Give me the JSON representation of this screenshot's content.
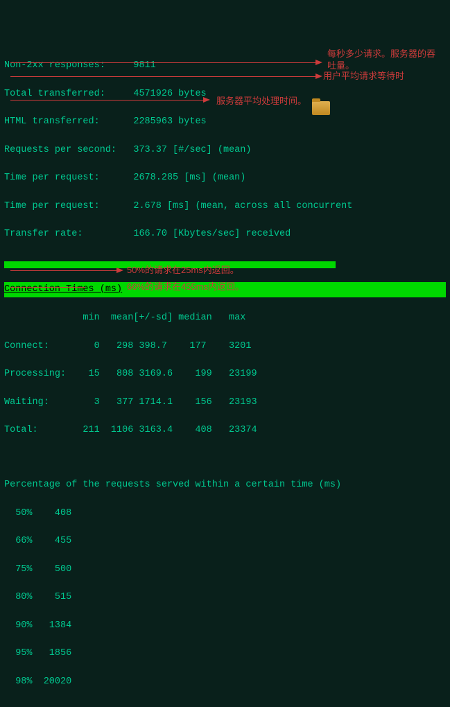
{
  "stats": {
    "non2xx": {
      "label": "Non-2xx responses:",
      "value": "9811"
    },
    "totalTransferred": {
      "label": "Total transferred:",
      "value": "4571926 bytes"
    },
    "htmlTransferred": {
      "label": "HTML transferred:",
      "value": "2285963 bytes"
    },
    "reqPerSec": {
      "label": "Requests per second:",
      "value": "373.37 [#/sec] (mean)"
    },
    "timePerReq1": {
      "label": "Time per request:",
      "value": "2678.285 [ms] (mean)"
    },
    "timePerReq2": {
      "label": "Time per request:",
      "value": "2.678 [ms] (mean, across all concurrent"
    },
    "transferRate": {
      "label": "Transfer rate:",
      "value": "166.70 [Kbytes/sec] received"
    }
  },
  "connHeader": "Connection Times (ms)",
  "connCols": "              min  mean[+/-sd] median   max",
  "connRows": {
    "connect": "Connect:        0   298 398.7    177    3201",
    "processing": "Processing:    15   808 3169.6    199   23199",
    "waiting": "Waiting:        3   377 1714.1    156   23193",
    "total": "Total:        211  1106 3163.4    408   23374"
  },
  "pctHeader": "Percentage of the requests served within a certain time (ms)",
  "pct": {
    "p50": "  50%    408",
    "p66": "  66%    455",
    "p75": "  75%    500",
    "p80": "  80%    515",
    "p90": "  90%   1384",
    "p95": "  95%   1856",
    "p98": "  98%  20020"
  },
  "annotations": {
    "a1": "每秒多少请求。服务器的吞吐量。",
    "a2": "用户平均请求等待时",
    "a3": "服务器平均处理时间。",
    "a4": "50%的请求在25ms内返回。",
    "a5": "66%的请求在455ms内返回。"
  }
}
